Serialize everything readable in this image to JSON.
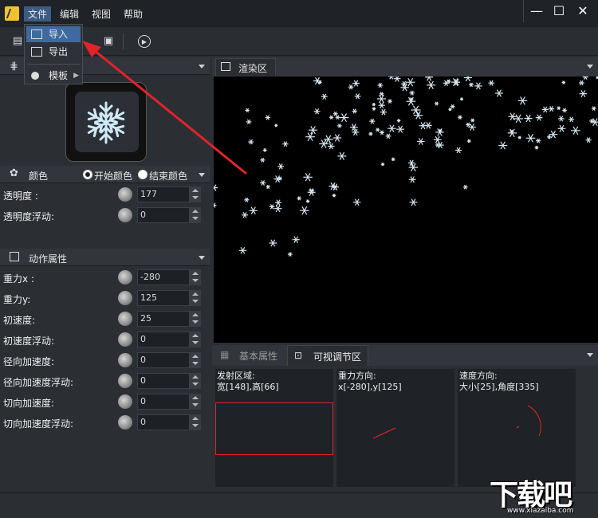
{
  "menu": {
    "items": [
      "文件",
      "编辑",
      "视图",
      "帮助"
    ]
  },
  "file_menu": {
    "import_label": "导入",
    "export_label": "导出",
    "template_label": "模板"
  },
  "color_section": {
    "title": "颜色",
    "start_color": "开始颜色",
    "end_color": "结束颜色"
  },
  "color_props": [
    {
      "label": "透明度 :",
      "value": "177"
    },
    {
      "label": "透明度浮动:",
      "value": "0"
    }
  ],
  "motion_section": {
    "title": "动作属性"
  },
  "motion_props": [
    {
      "label": "重力x :",
      "value": "-280"
    },
    {
      "label": "重力y:",
      "value": "125"
    },
    {
      "label": "初速度:",
      "value": "25"
    },
    {
      "label": "初速度浮动:",
      "value": "0"
    },
    {
      "label": "径向加速度:",
      "value": "0"
    },
    {
      "label": "径向加速度浮动:",
      "value": "0"
    },
    {
      "label": "切向加速度:",
      "value": "0"
    },
    {
      "label": "切向加速度浮动:",
      "value": "0"
    }
  ],
  "render": {
    "tab_label": "渲染区"
  },
  "bottom_tabs": {
    "basic_label": "基本属性",
    "visual_label": "可视调节区"
  },
  "emit_area": {
    "title": "发射区域:",
    "value": "宽[148],高[66]"
  },
  "gravity_dir": {
    "title": "重力方向:",
    "value": "x[-280],y[125]"
  },
  "speed_dir": {
    "title": "速度方向:",
    "value": "大小[25],角度[335]"
  },
  "watermark": {
    "text": "下载吧",
    "url": "www.xiazaiba.com"
  },
  "colors": {
    "accent": "#3f6aa0",
    "arrow": "#e0242a",
    "emit_rect": "#d62828"
  }
}
